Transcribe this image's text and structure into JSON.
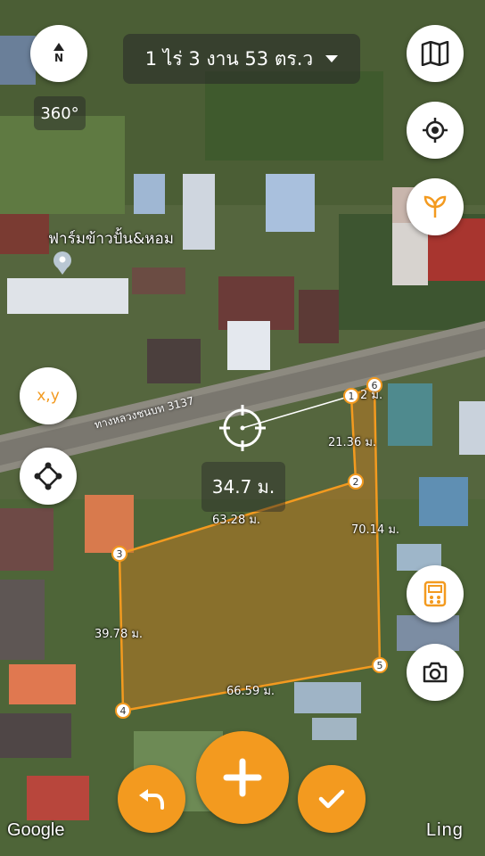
{
  "header": {
    "north_label": "N",
    "area_text": "1 ไร่ 3 งาน 53 ตร.ว",
    "heading_text": "360°"
  },
  "map": {
    "place_name": "ฟาร์มข้าวปั้น&หอม",
    "road_name": "ทางหลวงชนบท 3137",
    "current_distance": "34.7 ม.",
    "polygon_color": "#f39a1f",
    "segment_labels": {
      "s1_2": "21.36 ม.",
      "s2_3": "63.28 ม.",
      "s3_4": "39.78 ม.",
      "s4_5": "66.59 ม.",
      "s5_6": "70.14 ม.",
      "s6_1": "2 ม."
    },
    "vertices": [
      "1",
      "2",
      "3",
      "4",
      "5",
      "6"
    ],
    "attribution": "Google",
    "brand": "Ling"
  },
  "tools": {
    "xy_label": "x,y"
  },
  "icons": {
    "compass": "compass-icon",
    "layers": "map-icon",
    "locate": "crosshair-icon",
    "sprout": "sprout-icon",
    "polygon": "polygon-icon",
    "calculator": "calculator-icon",
    "camera": "camera-icon",
    "undo": "undo-icon",
    "add": "plus-icon",
    "done": "check-icon"
  }
}
